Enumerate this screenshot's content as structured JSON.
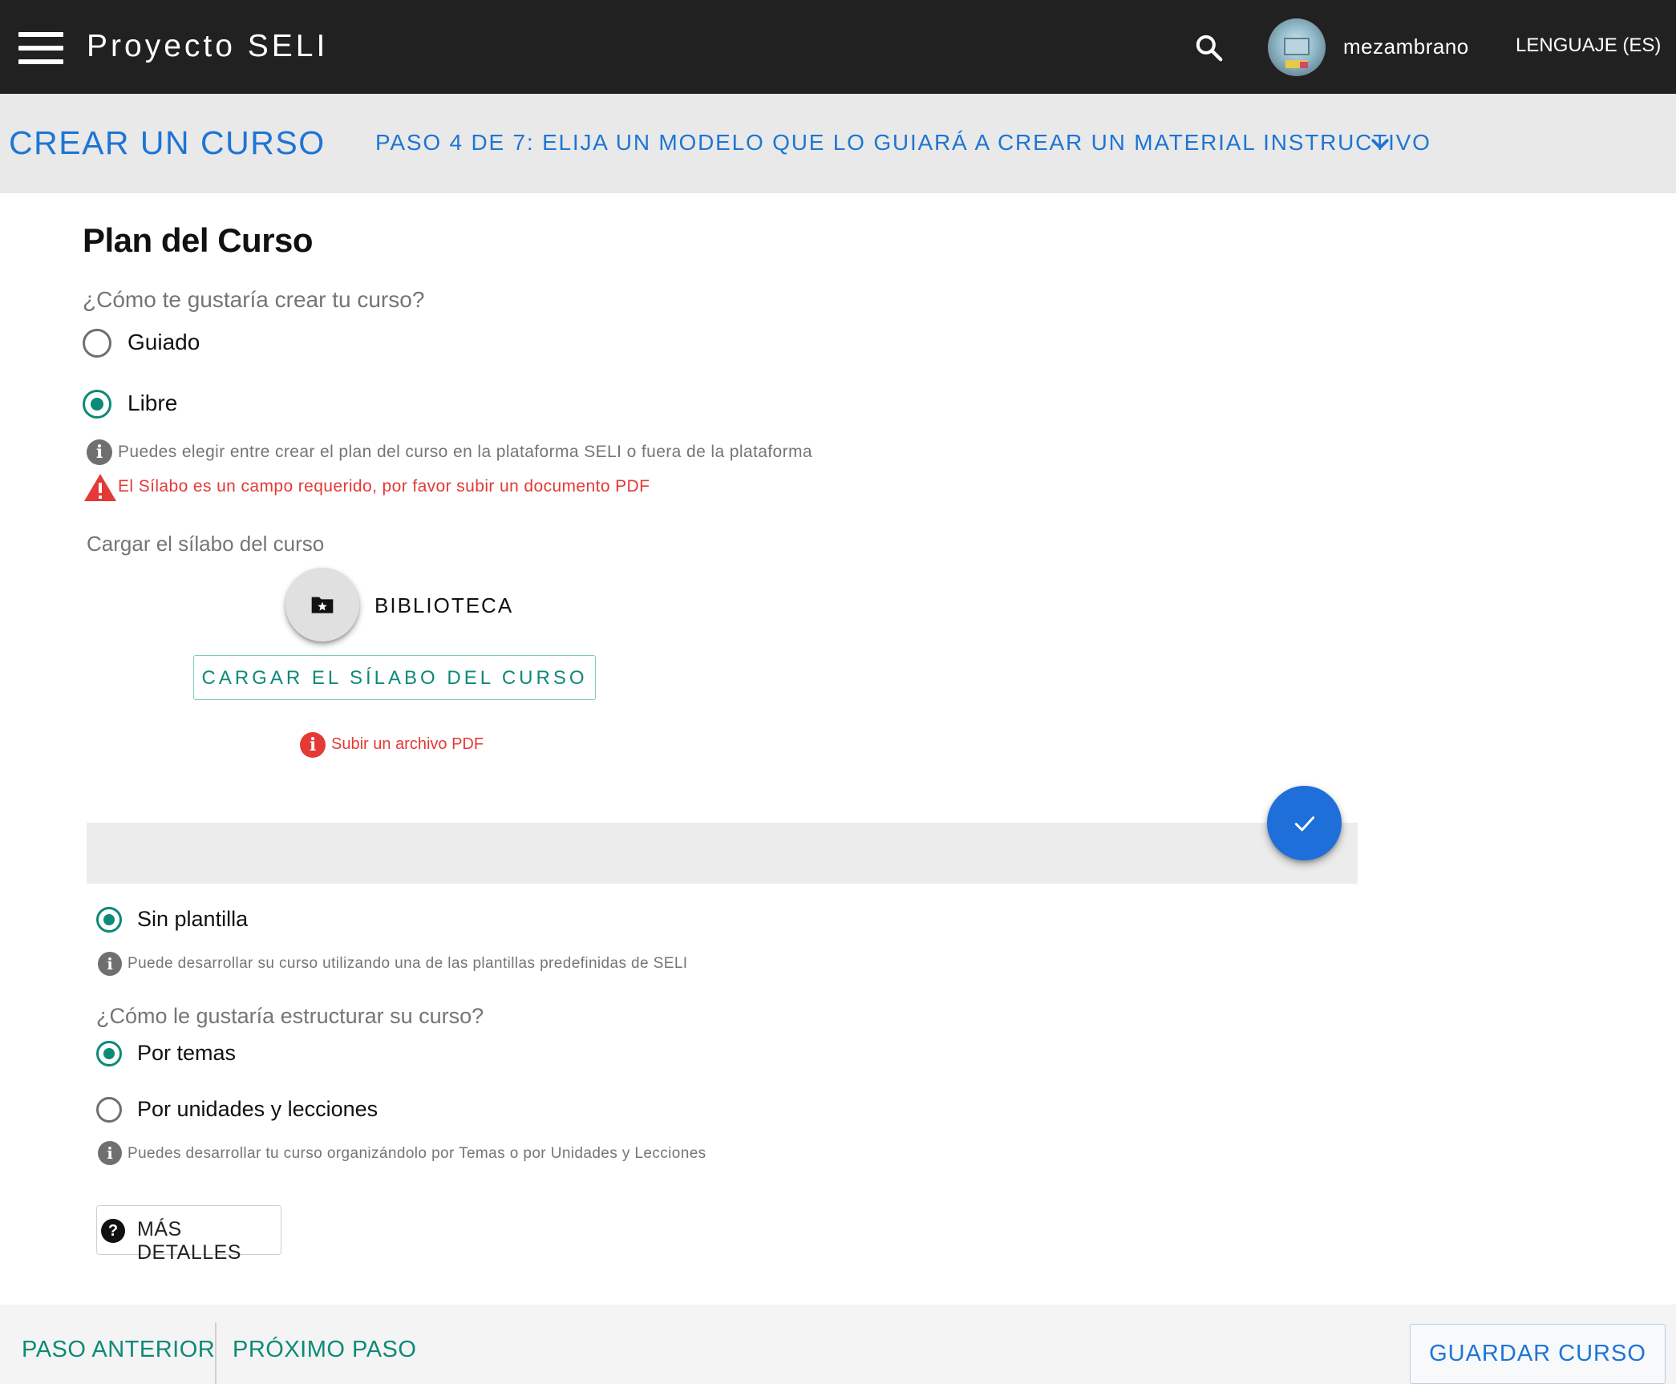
{
  "appbar": {
    "title": "Proyecto SELI",
    "username": "mezambrano",
    "language": "LENGUAJE (ES)"
  },
  "stepper": {
    "title": "CREAR UN CURSO",
    "step": "PASO 4 DE 7: ELIJA UN MODELO QUE LO GUIARÁ A CREAR UN MATERIAL INSTRUCTIVO"
  },
  "plan": {
    "heading": "Plan del Curso",
    "question": "¿Cómo te gustaría crear tu curso?",
    "options": [
      {
        "label": "Guiado",
        "selected": false
      },
      {
        "label": "Libre",
        "selected": true
      }
    ],
    "info": "Puedes elegir entre crear el plan del curso en la plataforma SELI o fuera de la plataforma",
    "error": "El Sílabo es un campo requerido, por favor subir un documento PDF"
  },
  "upload": {
    "label": "Cargar el sílabo del curso",
    "library": "BIBLIOTECA",
    "button": "CARGAR EL SÍLABO DEL CURSO",
    "note": "Subir un archivo PDF"
  },
  "template": {
    "option": "Sin plantilla",
    "info": "Puede desarrollar su curso utilizando una de las plantillas predefinidas de SELI"
  },
  "structure": {
    "question": "¿Cómo le gustaría estructurar su curso?",
    "options": [
      {
        "label": "Por temas",
        "selected": true
      },
      {
        "label": "Por unidades y lecciones",
        "selected": false
      }
    ],
    "info": "Puedes desarrollar tu curso organizándolo por Temas o por Unidades y Lecciones"
  },
  "details_button": "MÁS DETALLES",
  "footer": {
    "prev": "PASO ANTERIOR",
    "next": "PRÓXIMO PASO",
    "save": "GUARDAR CURSO"
  },
  "colors": {
    "appbar": "#212121",
    "primary_blue": "#1e75d4",
    "teal": "#0c8a78",
    "error": "#e53935",
    "stepbar": "#e9e9e9"
  },
  "icons": [
    "menu-icon",
    "search-icon",
    "chevron-down-icon",
    "info-icon",
    "warning-icon",
    "folder-star-icon",
    "check-icon",
    "help-icon"
  ]
}
